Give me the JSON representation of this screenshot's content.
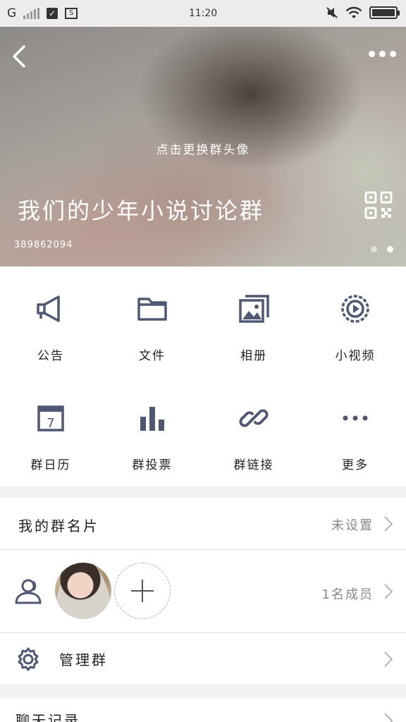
{
  "status_bar": {
    "network": "G",
    "time": "11:20"
  },
  "header": {
    "change_avatar_hint": "点击更换群头像",
    "group_name": "我们的少年小说讨论群",
    "group_id": "389862094",
    "back_icon": "chevron-left-icon",
    "more_icon": "more-dots-icon",
    "qr_icon": "qr-code-icon"
  },
  "grid": [
    {
      "label": "公告",
      "icon": "megaphone-icon"
    },
    {
      "label": "文件",
      "icon": "folder-icon"
    },
    {
      "label": "相册",
      "icon": "album-icon"
    },
    {
      "label": "小视频",
      "icon": "video-play-icon"
    },
    {
      "label": "群日历",
      "icon": "calendar-icon"
    },
    {
      "label": "群投票",
      "icon": "bar-chart-icon"
    },
    {
      "label": "群链接",
      "icon": "link-icon"
    },
    {
      "label": "更多",
      "icon": "more-dots-icon"
    }
  ],
  "calendar_day": "7",
  "rows": {
    "card": {
      "label": "我的群名片",
      "value": "未设置"
    },
    "members": {
      "value": "1名成员",
      "icon": "members-icon"
    },
    "manage": {
      "label": "管理群",
      "icon": "gear-icon"
    },
    "chat": {
      "label": "聊天记录"
    }
  },
  "colors": {
    "icon": "#4f5773",
    "background": "#f2f2f4"
  }
}
